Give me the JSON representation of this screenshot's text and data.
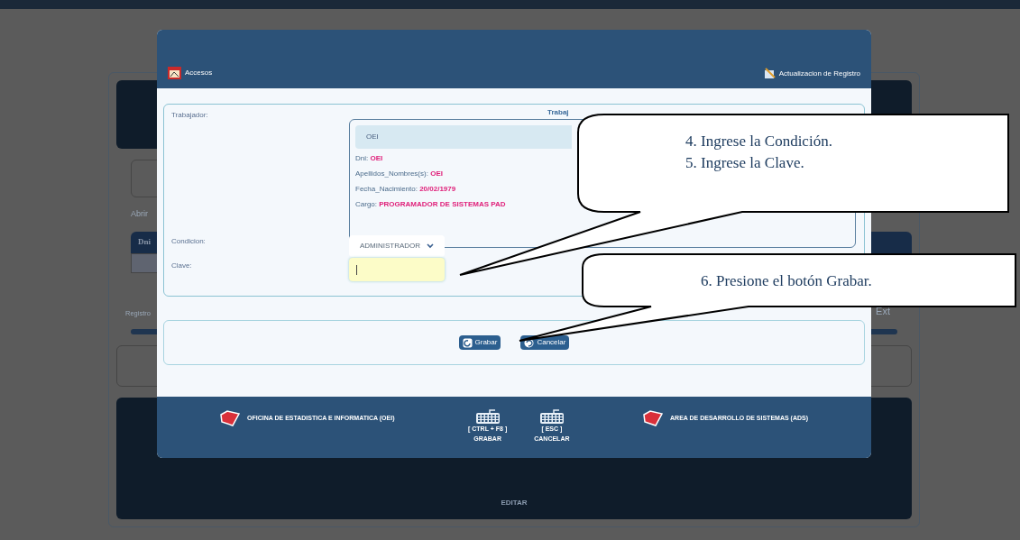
{
  "background_page": {
    "open_label": "Abrir",
    "table_header": "Dni",
    "records_label": "Registro",
    "next_label": "Ext",
    "footer_label": "EDITAR"
  },
  "modal": {
    "header": {
      "left_title": "Accesos",
      "right_title": "Actualizacion de Registro"
    },
    "worker_label": "Trabajador:",
    "card_title": "Trabaj",
    "selected_worker": "OEI",
    "fields": [
      {
        "label": "Dni:",
        "value": "OEI"
      },
      {
        "label": "Apellidos_Nombres(s):",
        "value": "OEI"
      },
      {
        "label": "Fecha_Nacimiento:",
        "value": "20/02/1979"
      },
      {
        "label": "Cargo:",
        "value": "PROGRAMADOR DE SISTEMAS PAD"
      }
    ],
    "condition_label": "Condicion:",
    "condition_value": "ADMINISTRADOR",
    "key_label": "Clave:",
    "key_focused": true,
    "buttons": [
      {
        "label": "Grabar",
        "kind": "save"
      },
      {
        "label": "Cancelar",
        "kind": "cancel"
      }
    ],
    "footer": {
      "left": "OFICINA DE ESTADISTICA E INFORMATICA (OEI)",
      "shortcuts": [
        {
          "keys": "[ CTRL + F8 ]",
          "action": "GRABAR"
        },
        {
          "keys": "[ ESC ]",
          "action": "CANCELAR"
        }
      ],
      "right": "AREA DE DESARROLLO DE SISTEMAS (ADS)"
    }
  },
  "callouts": [
    {
      "lines": [
        "4. Ingrese la Condición.",
        "5. Ingrese la Clave."
      ]
    },
    {
      "lines": [
        "6. Presione el botón Grabar."
      ]
    }
  ]
}
